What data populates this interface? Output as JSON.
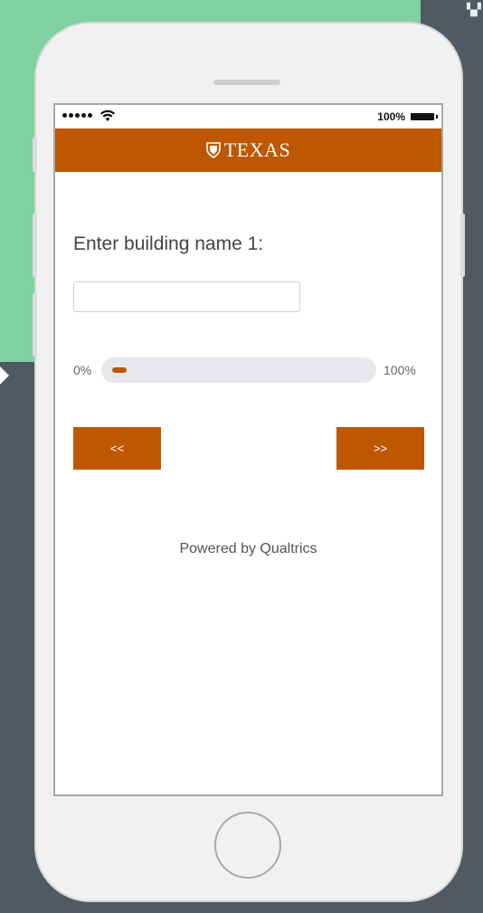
{
  "status_bar": {
    "battery_label": "100%"
  },
  "header": {
    "brand": "TEXAS"
  },
  "question": {
    "text": "Enter building name 1:"
  },
  "answer_input": {
    "value": ""
  },
  "progress": {
    "start_label": "0%",
    "end_label": "100%",
    "value_percent": 3
  },
  "navigation": {
    "back_label": "<<",
    "next_label": ">>"
  },
  "footer": {
    "powered_by": "Powered by Qualtrics"
  },
  "colors": {
    "accent": "#bf5700",
    "background": "#4f5a62",
    "green_panel": "#7fd1a0"
  }
}
